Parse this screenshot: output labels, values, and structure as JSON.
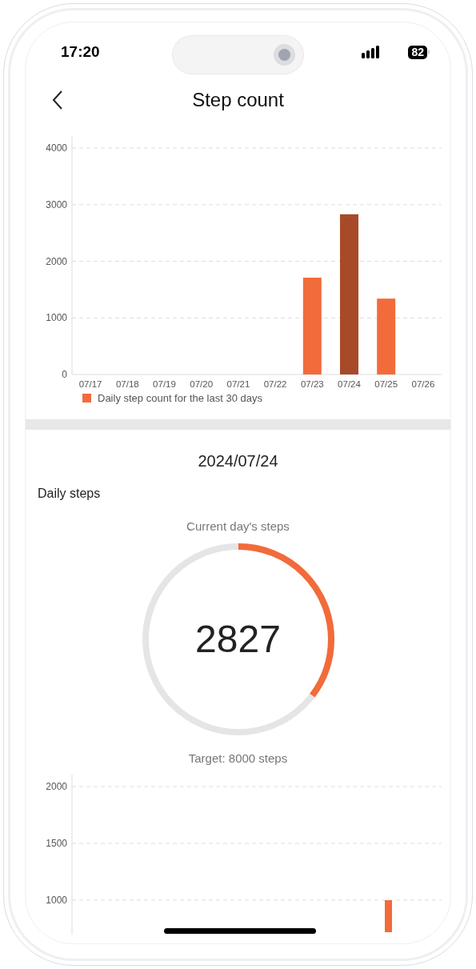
{
  "status_bar": {
    "time": "17:20",
    "battery": "82"
  },
  "nav": {
    "title": "Step count"
  },
  "history_chart": {
    "chart_data": {
      "type": "bar",
      "categories": [
        "07/17",
        "07/18",
        "07/19",
        "07/20",
        "07/21",
        "07/22",
        "07/23",
        "07/24",
        "07/25",
        "07/26"
      ],
      "ylim": [
        0,
        4000
      ],
      "yticks": [
        0,
        1000,
        2000,
        3000,
        4000
      ],
      "grid": true,
      "stacked": true,
      "series": [
        {
          "name": "Daily step count for the last 30 days",
          "color": "#f26b3a",
          "values": [
            0,
            0,
            0,
            0,
            0,
            0,
            1710,
            null,
            1340,
            0
          ]
        },
        {
          "color": "#a84a28",
          "values": [
            null,
            null,
            null,
            null,
            null,
            null,
            null,
            2830,
            null,
            null
          ]
        }
      ]
    }
  },
  "date": "2024/07/24",
  "section_title": "Daily steps",
  "ring": {
    "caption": "Current day's steps",
    "value": "2827",
    "target": "Target: 8000 steps"
  },
  "hourly_chart": {
    "y_labels": [
      "2000",
      "1500",
      "1000"
    ]
  }
}
